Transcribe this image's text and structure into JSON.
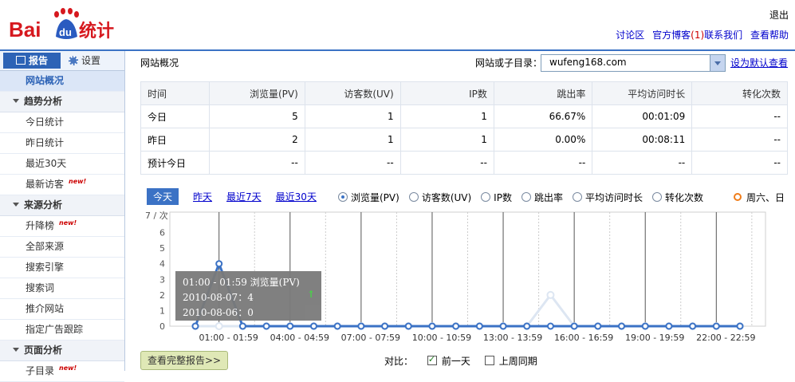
{
  "header": {
    "logo_text": "Bai",
    "logo_du": "du",
    "logo_suffix": "统计",
    "logout": "退出",
    "links": [
      "讨论区",
      "官方博客",
      "联系我们",
      "查看帮助"
    ],
    "blog_count": "(1)"
  },
  "sidebar": {
    "tab_report": "报告",
    "tab_settings": "设置",
    "items": [
      {
        "type": "item",
        "label": "网站概况",
        "active": true
      },
      {
        "type": "group",
        "label": "趋势分析"
      },
      {
        "type": "item",
        "label": "今日统计"
      },
      {
        "type": "item",
        "label": "昨日统计"
      },
      {
        "type": "item",
        "label": "最近30天"
      },
      {
        "type": "item",
        "label": "最新访客",
        "new": "new!"
      },
      {
        "type": "group",
        "label": "来源分析"
      },
      {
        "type": "item",
        "label": "升降榜",
        "new": "new!"
      },
      {
        "type": "item",
        "label": "全部来源"
      },
      {
        "type": "item",
        "label": "搜索引擎"
      },
      {
        "type": "item",
        "label": "搜索词"
      },
      {
        "type": "item",
        "label": "推介网站"
      },
      {
        "type": "item",
        "label": "指定广告跟踪"
      },
      {
        "type": "group",
        "label": "页面分析"
      },
      {
        "type": "item",
        "label": "子目录",
        "new": "new!"
      }
    ]
  },
  "main": {
    "crumb": "网站概况",
    "site_label": "网站或子目录：",
    "site_value": "wufeng168.com",
    "set_default": "设为默认查看"
  },
  "table": {
    "headers": [
      "时间",
      "浏览量(PV)",
      "访客数(UV)",
      "IP数",
      "跳出率",
      "平均访问时长",
      "转化次数"
    ],
    "rows": [
      [
        "今日",
        "5",
        "1",
        "1",
        "66.67%",
        "00:01:09",
        "--"
      ],
      [
        "昨日",
        "2",
        "1",
        "1",
        "0.00%",
        "00:08:11",
        "--"
      ],
      [
        "预计今日",
        "--",
        "--",
        "--",
        "--",
        "--",
        "--"
      ]
    ]
  },
  "ranges": [
    "今天",
    "昨天",
    "最近7天",
    "最近30天"
  ],
  "metrics": [
    "浏览量(PV)",
    "访客数(UV)",
    "IP数",
    "跳出率",
    "平均访问时长",
    "转化次数"
  ],
  "weekend_legend": "周六、日",
  "tooltip": {
    "line1": "01:00 - 01:59  浏览量(PV)",
    "line2": "2010-08-07：4",
    "line3": "2010-08-06：0",
    "up_icon": "arrow-up-icon"
  },
  "footer": {
    "full_report": "查看完整报告>>",
    "compare_label": "对比：",
    "prev_day": "前一天",
    "prev_week": "上周同期"
  },
  "colors": {
    "accent": "#3b72c5",
    "series_today": "#3b72c5",
    "series_prev": "#dde6f2"
  },
  "chart_data": {
    "type": "line",
    "ylabel": "7 / 次",
    "ylim": [
      0,
      7
    ],
    "yticks": [
      0,
      1,
      2,
      3,
      4,
      5,
      6
    ],
    "xtick_labels": [
      "01:00 - 01:59",
      "04:00 - 04:59",
      "07:00 - 07:59",
      "10:00 - 10:59",
      "13:00 - 13:59",
      "16:00 - 16:59",
      "19:00 - 19:59",
      "22:00 - 22:59"
    ],
    "x": [
      "00:00",
      "01:00",
      "02:00",
      "03:00",
      "04:00",
      "05:00",
      "06:00",
      "07:00",
      "08:00",
      "09:00",
      "10:00",
      "11:00",
      "12:00",
      "13:00",
      "14:00",
      "15:00",
      "16:00",
      "17:00",
      "18:00",
      "19:00",
      "20:00",
      "21:00",
      "22:00",
      "23:00"
    ],
    "series": [
      {
        "values": [
          0,
          4,
          0,
          0,
          0,
          0,
          0,
          0,
          0,
          0,
          0,
          0,
          0,
          0,
          0,
          0,
          0,
          0,
          0,
          0,
          0,
          0,
          0,
          0
        ]
      },
      {
        "values": [
          0,
          0,
          0,
          0,
          0,
          0,
          0,
          0,
          0,
          0,
          0,
          0,
          0,
          0,
          0,
          2,
          0,
          0,
          0,
          0,
          0,
          0,
          0,
          0
        ]
      }
    ]
  }
}
